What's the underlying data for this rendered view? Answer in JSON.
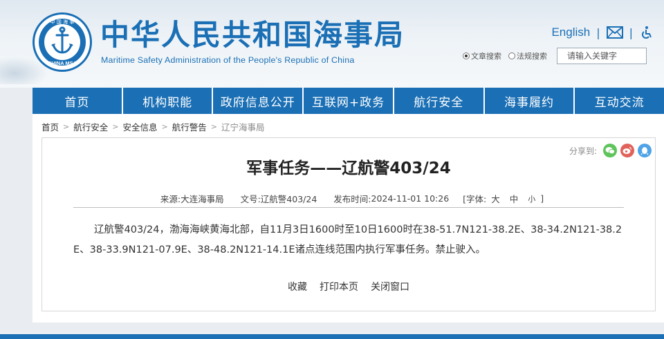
{
  "header": {
    "site_title": "中华人民共和国海事局",
    "site_subtitle": "Maritime Safety Administration of the People's Republic of China",
    "logo_top_text": "中 国 海 事",
    "logo_bottom_text": "CHINA MSA",
    "english_link": "English",
    "search": {
      "option_article": "文章搜索",
      "option_regulation": "法规搜索",
      "placeholder": "请输入关键字"
    }
  },
  "nav": {
    "items": [
      {
        "label": "首页"
      },
      {
        "label": "机构职能"
      },
      {
        "label": "政府信息公开"
      },
      {
        "label": "互联网+政务"
      },
      {
        "label": "航行安全"
      },
      {
        "label": "海事履约"
      },
      {
        "label": "互动交流"
      }
    ]
  },
  "breadcrumb": {
    "items": [
      "首页",
      "航行安全",
      "安全信息",
      "航行警告",
      "辽宁海事局"
    ],
    "separator": ">"
  },
  "article": {
    "share_label": "分享到:",
    "title": "军事任务——辽航警403/24",
    "meta": {
      "source_label": "来源:",
      "source": "大连海事局",
      "doc_label": "文号:",
      "doc_no": "辽航警403/24",
      "date_label": "发布时间:",
      "date": "2024-11-01 10:26",
      "font_label": "[字体:",
      "font_large": "大",
      "font_medium": "中",
      "font_small": "小",
      "font_close": "]"
    },
    "content": "辽航警403/24，渤海海峡黄海北部，自11月3日1600时至10日1600时在38-51.7N121-38.2E、38-34.2N121-38.2E、38-33.9N121-07.9E、38-48.2N121-14.1E诸点连线范围内执行军事任务。禁止驶入。",
    "actions": {
      "favorite": "收藏",
      "print": "打印本页",
      "close": "关闭窗口"
    }
  },
  "colors": {
    "brand_blue": "#1a6fb5",
    "wechat_green": "#5ec45b",
    "weibo_red": "#e0625a",
    "qq_blue": "#4fa3e6"
  }
}
